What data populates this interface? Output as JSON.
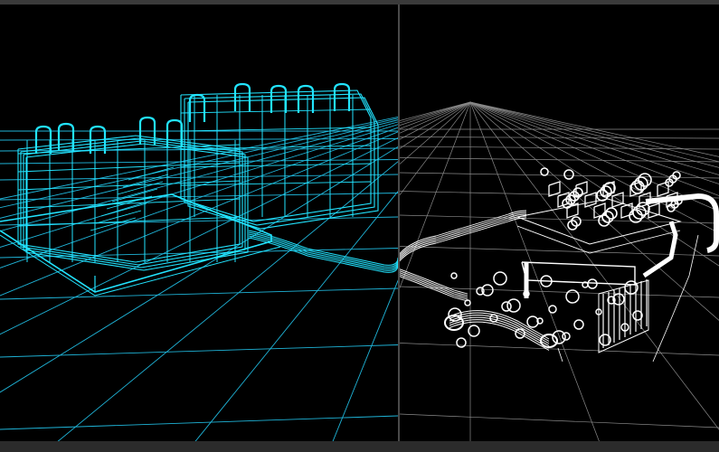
{
  "colors": {
    "background": "#000000",
    "wireframe_left": "#22e4ff",
    "grid_left": "#1fb4d8",
    "wireframe_right": "#ffffff",
    "grid_right": "#8a8a8a",
    "divider": "#4a4a4a",
    "top_bar": "#3a3a3a",
    "bottom_bar": "#2b2b2b"
  },
  "viewports": [
    {
      "id": "left",
      "render_mode": "cyan-wireframe"
    },
    {
      "id": "right",
      "render_mode": "white-wireframe"
    }
  ]
}
